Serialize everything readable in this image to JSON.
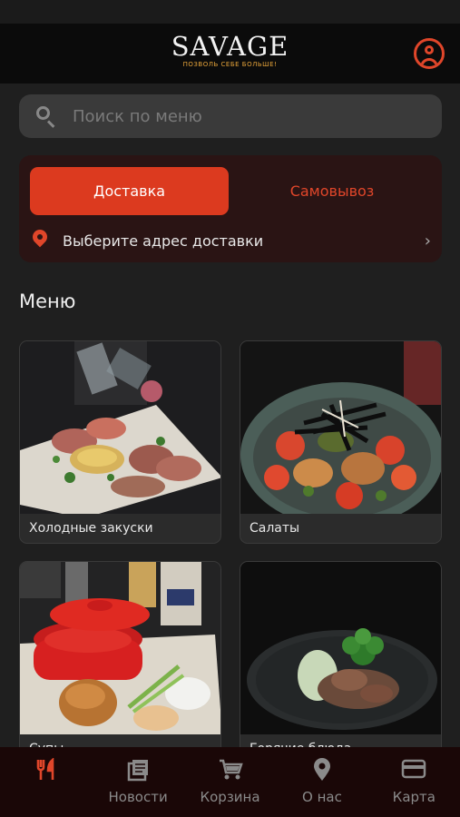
{
  "header": {
    "brand": "SAVAGE",
    "tagline": "ПОЗВОЛЬ СЕБЕ БОЛЬШЕ!"
  },
  "search": {
    "placeholder": "Поиск по меню"
  },
  "delivery": {
    "tab_delivery": "Доставка",
    "tab_pickup": "Самовывоз",
    "address_prompt": "Выберите адрес доставки"
  },
  "menu": {
    "title": "Меню",
    "categories": [
      {
        "label": "Холодные закуски"
      },
      {
        "label": "Салаты"
      },
      {
        "label": "Супы"
      },
      {
        "label": "Горячие блюда"
      }
    ]
  },
  "nav": {
    "items": [
      {
        "label": ""
      },
      {
        "label": "Новости"
      },
      {
        "label": "Корзина"
      },
      {
        "label": "О нас"
      },
      {
        "label": "Карта"
      }
    ]
  },
  "colors": {
    "accent": "#dc3a1f",
    "header_bg": "#0b0b0b",
    "card_bg": "#2a1414",
    "tagline": "#e8a53a"
  }
}
